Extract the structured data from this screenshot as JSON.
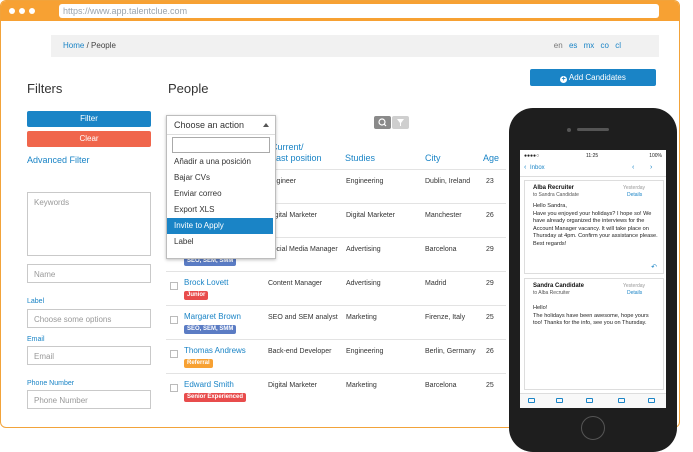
{
  "browser": {
    "url": "https://www.app.talentclue.com"
  },
  "breadcrumb": {
    "home": "Home",
    "separator": "/",
    "current": "People"
  },
  "languages": [
    "en",
    "es",
    "mx",
    "co",
    "cl"
  ],
  "filters": {
    "title": "Filters",
    "filter_button": "Filter",
    "clear_button": "Clear",
    "advanced": "Advanced Filter",
    "keywords_placeholder": "Keywords",
    "name_placeholder": "Name",
    "label_label": "Label",
    "label_placeholder": "Choose some options",
    "email_label": "Email",
    "email_placeholder": "Email",
    "phone_label": "Phone Number",
    "phone_placeholder": "Phone Number"
  },
  "people": {
    "title": "People",
    "add_button": "Add Candidates",
    "columns": {
      "position_line1": "Current/",
      "position_line2": "Last position",
      "studies": "Studies",
      "city": "City",
      "age": "Age"
    },
    "rows": [
      {
        "name": "",
        "tag": "",
        "position": "Engineer",
        "studies": "Engineering",
        "city": "Dublin, Ireland",
        "age": "23"
      },
      {
        "name": "",
        "tag": "",
        "position": "Digital Marketer",
        "studies": "Digital Marketer",
        "city": "Manchester",
        "age": "26"
      },
      {
        "name": "",
        "tag": "SEO, SEM, SMM",
        "position": "Social Media Manager",
        "studies": "Advertising",
        "city": "Barcelona",
        "age": "29"
      },
      {
        "name": "Brock Lovett",
        "tag": "Junior",
        "position": "Content Manager",
        "studies": "Advertising",
        "city": "Madrid",
        "age": "29"
      },
      {
        "name": "Margaret Brown",
        "tag": "SEO, SEM, SMM",
        "position": "SEO and SEM analyst",
        "studies": "Marketing",
        "city": "Firenze, Italy",
        "age": "25"
      },
      {
        "name": "Thomas Andrews",
        "tag": "Referral",
        "position": "Back-end Developer",
        "studies": "Engineering",
        "city": "Berlin, Germany",
        "age": "26"
      },
      {
        "name": "Edward Smith",
        "tag": "Senior Experienced",
        "position": "Digital Marketer",
        "studies": "Marketing",
        "city": "Barcelona",
        "age": "25"
      }
    ]
  },
  "action_menu": {
    "header": "Choose an action",
    "items": [
      "Añadir a una posición",
      "Bajar CVs",
      "Enviar correo",
      "Export XLS",
      "Invite to Apply",
      "Label"
    ],
    "selected_index": 4
  },
  "phone": {
    "time": "11:25",
    "carrier": "●●●●○",
    "battery": "100%",
    "back_label": "Inbox",
    "messages": [
      {
        "from": "Alba Recruiter",
        "to": "to Sandra Candidate",
        "date": "Yesterday",
        "details": "Details",
        "body": "Hello Sandra,\nHave you enjoyed your holidays? I hope so! We have already organized the interviews for the Account Manager vacancy. It will take place on Thursday at 4pm. Confirm your assistance please. Best regards!"
      },
      {
        "from": "Sandra Candidate",
        "to": "to Alba Recruiter",
        "date": "Yesterday",
        "details": "Details",
        "body": "Hello!\nThe holidays have been awesome, hope yours too! Thanks for the info, see you on Thursday."
      }
    ]
  },
  "colors": {
    "brand_orange": "#f7a133",
    "accent_blue": "#1a84c6",
    "clear_red": "#f0664c"
  },
  "tag_colors": {
    "SEO, SEM, SMM": "#5b7cc4",
    "Junior": "#e84c4c",
    "Referral": "#f7a133",
    "Senior Experienced": "#e84c4c"
  }
}
